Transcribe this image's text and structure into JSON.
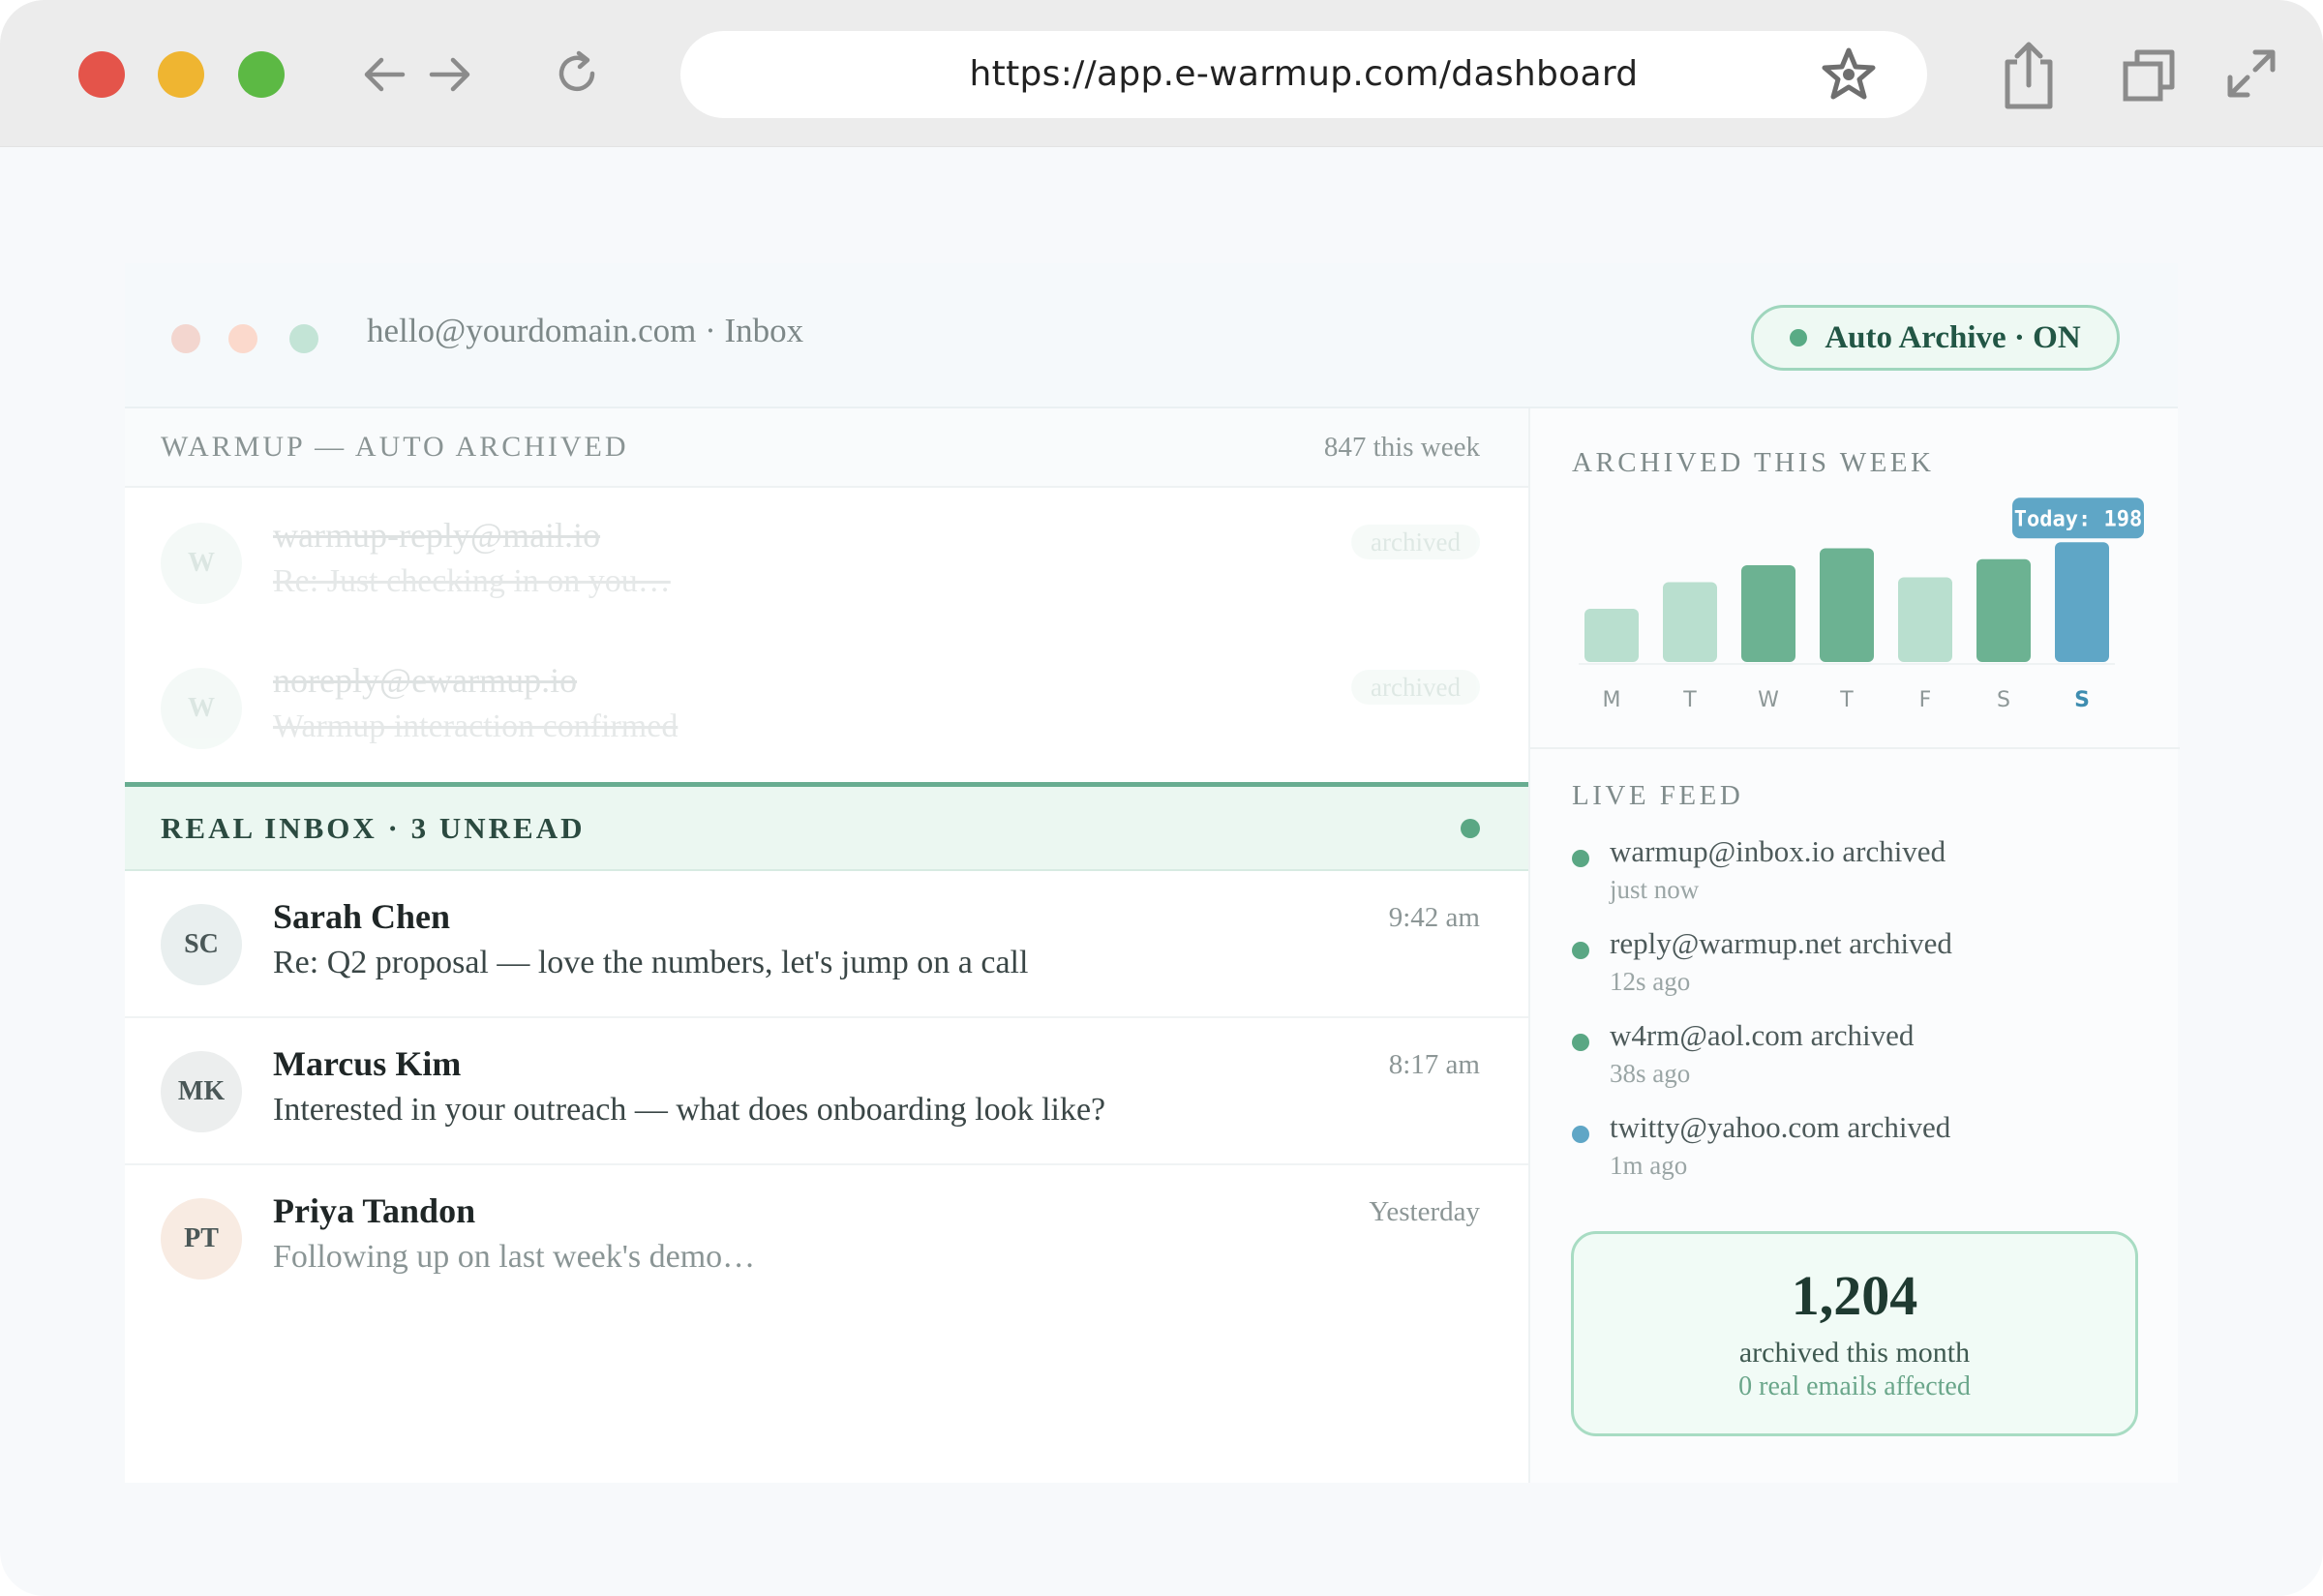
{
  "browser": {
    "url": "https://app.e-warmup.com/dashboard",
    "icons": [
      "back-arrow-icon",
      "forward-arrow-icon",
      "reload-icon",
      "star-icon",
      "share-icon",
      "tabs-icon",
      "fullscreen-icon"
    ]
  },
  "app": {
    "account": "hello@yourdomain.com · Inbox",
    "auto_archive_label": "Auto Archive · ON",
    "colors": {
      "accent_green": "#68ad91",
      "accent_blue": "#5fa6c6",
      "light_green": "#b9dfcf"
    }
  },
  "warmup": {
    "title": "WARMUP — AUTO ARCHIVED",
    "count": "847 this week",
    "items": [
      {
        "avatar": "W",
        "sender": "warmup-reply@mail.io",
        "subject": "Re: Just checking in on you…",
        "badge": "archived"
      },
      {
        "avatar": "W",
        "sender": "noreply@ewarmup.io",
        "subject": "Warmup interaction confirmed",
        "badge": "archived"
      }
    ]
  },
  "real_inbox": {
    "title": "REAL INBOX · 3 UNREAD",
    "messages": [
      {
        "initials": "SC",
        "sender": "Sarah Chen",
        "subject": "Re: Q2 proposal — love the numbers, let's jump on a call",
        "time": "9:42 am"
      },
      {
        "initials": "MK",
        "sender": "Marcus Kim",
        "subject": "Interested in your outreach — what does onboarding look like?",
        "time": "8:17 am"
      },
      {
        "initials": "PT",
        "sender": "Priya Tandon",
        "subject": "Following up on last week's demo…",
        "time": "Yesterday"
      }
    ]
  },
  "archived_week": {
    "title": "ARCHIVED THIS WEEK"
  },
  "chart_data": {
    "type": "bar",
    "categories": [
      "M",
      "T",
      "W",
      "T",
      "F",
      "S",
      "S"
    ],
    "values": [
      88,
      132,
      160,
      188,
      140,
      170,
      198
    ],
    "highlight_index": 6,
    "highlight_label": "Today: 198",
    "ylim": [
      0,
      240
    ],
    "grid": false,
    "bar_colors": [
      "#b9dfcf",
      "#b9dfcf",
      "#6cb292",
      "#6cb292",
      "#b9dfcf",
      "#6cb292",
      "#5fa6c6"
    ]
  },
  "live_feed": {
    "title": "LIVE FEED",
    "items": [
      {
        "text": "warmup@inbox.io archived",
        "time": "just now",
        "color": "#5aa784"
      },
      {
        "text": "reply@warmup.net archived",
        "time": "12s ago",
        "color": "#5aa784"
      },
      {
        "text": "w4rm@aol.com archived",
        "time": "38s ago",
        "color": "#5aa784"
      },
      {
        "text": "twitty@yahoo.com archived",
        "time": "1m ago",
        "color": "#5fa6c6"
      }
    ]
  },
  "stats": {
    "number": "1,204",
    "label": "archived this month",
    "sub": "0 real emails affected"
  }
}
